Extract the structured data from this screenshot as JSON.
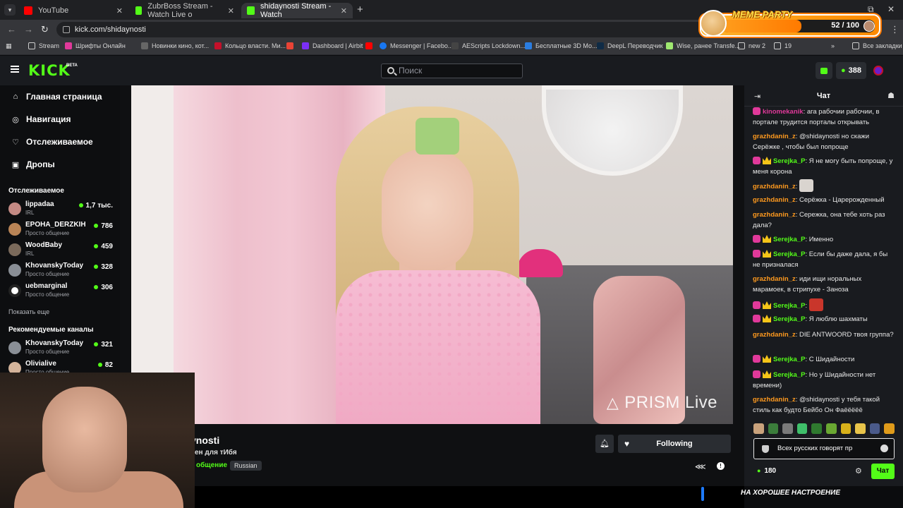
{
  "browser": {
    "tabs": [
      {
        "label": "YouTube",
        "color": "#ff0000"
      },
      {
        "label": "ZubrBoss Stream - Watch Live o",
        "color": "#53fc18"
      },
      {
        "label": "shidaynosti Stream - Watch",
        "color": "#53fc18"
      }
    ],
    "url": "kick.com/shidaynosti",
    "bookmarks": [
      {
        "label": "Stream",
        "icon": "folder-icon"
      },
      {
        "label": "Шрифты Онлайн",
        "icon": "fonts-icon"
      },
      {
        "label": "Новинки кино, кот...",
        "icon": "film-icon"
      },
      {
        "label": "Кольцо власти. Ми...",
        "icon": "r-icon"
      },
      {
        "label": "Dashboard | Airbit",
        "icon": "airbit-icon"
      },
      {
        "label": "Messenger | Facebo...",
        "icon": "facebook-icon"
      },
      {
        "label": "AEScripts Lockdown...",
        "icon": "ae-icon"
      },
      {
        "label": "Бесплатные 3D Мо...",
        "icon": "3d-icon"
      },
      {
        "label": "DeepL Переводчик",
        "icon": "deepl-icon"
      },
      {
        "label": "Wise, ранее Transfe...",
        "icon": "wise-icon"
      },
      {
        "label": "new 2",
        "icon": "folder-icon"
      },
      {
        "label": "19",
        "icon": "folder-icon"
      },
      {
        "label": "Все закладки",
        "icon": "folder-icon"
      }
    ]
  },
  "meme_party": {
    "title": "MEME PARTY",
    "count": "52 / 100",
    "progress_fraction": 0.52
  },
  "header": {
    "search_placeholder": "Поиск",
    "points_value": "388"
  },
  "sidebar": {
    "nav": [
      {
        "label": "Главная страница",
        "icon": "home-icon"
      },
      {
        "label": "Навигация",
        "icon": "compass-icon"
      },
      {
        "label": "Отслеживаемое",
        "icon": "heart-icon"
      },
      {
        "label": "Дропы",
        "icon": "gift-icon"
      }
    ],
    "following_title": "Отслеживаемое",
    "following": [
      {
        "name": "lippadaa",
        "category": "IRL",
        "viewers": "1,7 тыс."
      },
      {
        "name": "EPOHA_DERZKIH",
        "category": "Просто общение",
        "viewers": "786"
      },
      {
        "name": "WoodBaby",
        "category": "IRL",
        "viewers": "459"
      },
      {
        "name": "KhovanskyToday",
        "category": "Просто общение",
        "viewers": "328"
      },
      {
        "name": "uebmarginal",
        "category": "Просто общение",
        "viewers": "306"
      }
    ],
    "show_more": "Показать еще",
    "recommended_title": "Рекомендуемые каналы",
    "recommended": [
      {
        "name": "KhovanskyToday",
        "category": "Просто общение",
        "viewers": "321"
      },
      {
        "name": "Olivialive",
        "category": "Просто общение",
        "viewers": "82"
      }
    ]
  },
  "player": {
    "watermark": "PRISM Live"
  },
  "stream": {
    "name": "ynosti",
    "title": "ен для тИбя",
    "category": "общение",
    "tag": "Russian",
    "follow_label": "Following"
  },
  "overlay": {
    "mood_text": "НА ХОРОШЕЕ НАСТРОЕНИЕ"
  },
  "chat": {
    "title": "Чат",
    "messages": [
      {
        "user": "kinomekanik",
        "color": "#e0399a",
        "badges": [
          "sub"
        ],
        "text": "ага рабочии рабочии, в портале трудится порталы открывать"
      },
      {
        "user": "grazhdanin_z",
        "color": "#ff9a1f",
        "badges": [],
        "text": "@shidaynosti но скажи Серёжке , чтобы был попроще"
      },
      {
        "user": "Serejka_P",
        "color": "#53fc18",
        "badges": [
          "sub",
          "crown"
        ],
        "text": "Я не могу быть попроще, у меня корона"
      },
      {
        "user": "grazhdanin_z",
        "color": "#ff9a1f",
        "badges": [],
        "text": "",
        "emote": "cat-emote"
      },
      {
        "user": "grazhdanin_z",
        "color": "#ff9a1f",
        "badges": [],
        "text": "Серёжка - Царерожденный"
      },
      {
        "user": "grazhdanin_z",
        "color": "#ff9a1f",
        "badges": [],
        "text": "Сережка, она тебе хоть раз дала?"
      },
      {
        "user": "Serejka_P",
        "color": "#53fc18",
        "badges": [
          "sub",
          "crown"
        ],
        "text": "Именно"
      },
      {
        "user": "Serejka_P",
        "color": "#53fc18",
        "badges": [
          "sub",
          "crown"
        ],
        "text": "Если бы даже дала, я бы не призналася"
      },
      {
        "user": "grazhdanin_z",
        "color": "#ff9a1f",
        "badges": [],
        "text": "иди ищи норальных марамоек, в стрипухе - Заноза"
      },
      {
        "user": "Serejka_P",
        "color": "#53fc18",
        "badges": [
          "sub",
          "crown"
        ],
        "text": "",
        "emote": "devil-emote"
      },
      {
        "user": "Serejka_P",
        "color": "#53fc18",
        "badges": [
          "sub",
          "crown"
        ],
        "text": "Я люблю шахматы"
      },
      {
        "user": "grazhdanin_z",
        "color": "#ff9a1f",
        "badges": [],
        "text": "DIE ANTWOORD твоя группа?"
      },
      {
        "user": "Serejka_P",
        "color": "#53fc18",
        "badges": [
          "sub",
          "crown"
        ],
        "text": "С Шидайности"
      },
      {
        "user": "Serejka_P",
        "color": "#53fc18",
        "badges": [
          "sub",
          "crown"
        ],
        "text": "Но у Шидайности нет времени)"
      },
      {
        "user": "grazhdanin_z",
        "color": "#ff9a1f",
        "badges": [],
        "text": "@shidaynosti у тебя такой стиль как будто Бейбо Он Фаёёёёё"
      }
    ],
    "input_value": "Всех русских говорят пр",
    "points": "180",
    "send_label": "Чат"
  },
  "colors": {
    "kick_green": "#53fc18",
    "chat_bg": "#191b1f",
    "page_bg": "#0b0c0e"
  }
}
